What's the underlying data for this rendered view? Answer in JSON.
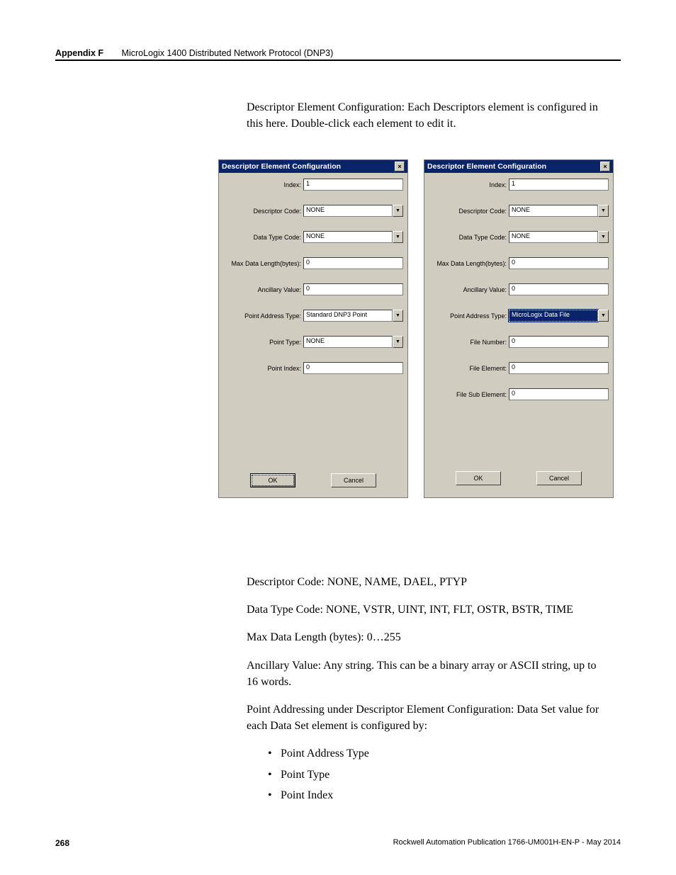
{
  "header": {
    "appendix_label": "Appendix F",
    "appendix_title": "MicroLogix 1400 Distributed Network Protocol (DNP3)"
  },
  "intro": "Descriptor Element Configuration: Each Descriptors element is configured in this here. Double-click each element to edit it.",
  "dialog_title": "Descriptor Element Configuration",
  "labels": {
    "index": "Index:",
    "descriptor_code": "Descriptor Code:",
    "data_type_code": "Data Type Code:",
    "max_data_length": "Max Data Length(bytes):",
    "ancillary_value": "Ancillary Value:",
    "point_address_type": "Point Address Type:",
    "point_type": "Point Type:",
    "point_index": "Point Index:",
    "file_number": "File Number:",
    "file_element": "File Element:",
    "file_sub_element": "File Sub Element:"
  },
  "d1": {
    "index": "1",
    "descriptor_code": "NONE",
    "data_type_code": "NONE",
    "max_data_length": "0",
    "ancillary_value": "0",
    "point_address_type": "Standard DNP3 Point",
    "point_type": "NONE",
    "point_index": "0"
  },
  "d2": {
    "index": "1",
    "descriptor_code": "NONE",
    "data_type_code": "NONE",
    "max_data_length": "0",
    "ancillary_value": "0",
    "point_address_type": "MicroLogix Data File",
    "file_number": "0",
    "file_element": "0",
    "file_sub_element": "0"
  },
  "buttons": {
    "ok": "OK",
    "cancel": "Cancel"
  },
  "defs": {
    "p1": "Descriptor Code: NONE, NAME, DAEL, PTYP",
    "p2": "Data Type Code: NONE, VSTR, UINT, INT, FLT, OSTR, BSTR, TIME",
    "p3": "Max Data Length (bytes): 0…255",
    "p4": "Ancillary Value: Any string. This can be a binary array or ASCII string, up to 16 words.",
    "p5": "Point Addressing under Descriptor Element Configuration: Data Set value for each Data Set element is configured by:",
    "b1": "Point Address Type",
    "b2": "Point Type",
    "b3": "Point Index"
  },
  "footer": {
    "page": "268",
    "pub": "Rockwell Automation Publication 1766-UM001H-EN-P - May 2014"
  }
}
